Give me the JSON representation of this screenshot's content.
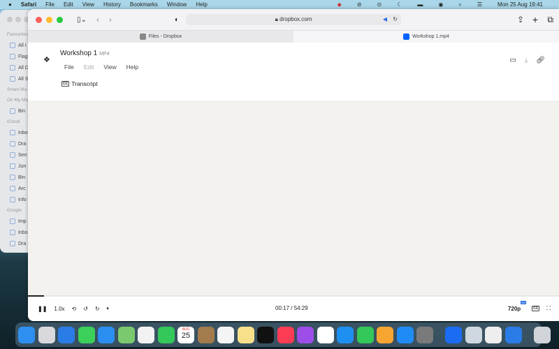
{
  "menubar": {
    "app": "Safari",
    "items": [
      "File",
      "Edit",
      "View",
      "History",
      "Bookmarks",
      "Window",
      "Help"
    ],
    "clock": "Mon 25 Aug  19:41"
  },
  "mail": {
    "sections": [
      {
        "label": "Favourites",
        "items": [
          "All I",
          "Flag",
          "All D",
          "All S"
        ]
      },
      {
        "label": "Smart Ma",
        "items": []
      },
      {
        "label": "On My Ma",
        "items": [
          "Bin"
        ]
      },
      {
        "label": "iCloud",
        "items": [
          "Inbo",
          "Dra",
          "Sen",
          "Jun",
          "Bin",
          "Arc",
          "Info"
        ]
      },
      {
        "label": "Google",
        "items": [
          "Imp",
          "Inbo",
          "Dra"
        ]
      }
    ]
  },
  "safari": {
    "url": "dropbox.com",
    "tabs": [
      {
        "label": "Files - Dropbox",
        "active": false
      },
      {
        "label": "Workshop 1.mp4",
        "active": true
      }
    ]
  },
  "file": {
    "name": "Workshop 1",
    "type": "MP4",
    "menus": [
      "File",
      "Edit",
      "View",
      "Help"
    ],
    "transcript": "Transcript",
    "cc": "CC"
  },
  "player": {
    "speed": "1.0x",
    "time": "00:17 / 54:29",
    "quality": "720p",
    "hd": "HD",
    "progress_fraction": 0.005
  },
  "dock": {
    "calendar_day": "25",
    "calendar_month": "AUG",
    "apps": [
      "Finder",
      "Launchpad",
      "Safari",
      "Messages",
      "Mail",
      "Maps",
      "Photos",
      "FaceTime",
      "Calendar",
      "Contacts",
      "Reminders",
      "Notes",
      "TV",
      "Music",
      "Podcasts",
      "News",
      "Keynote",
      "Numbers",
      "Pages",
      "App Store",
      "System Settings",
      "Zoom",
      "Preview",
      "Preview2",
      "Safari",
      "Bin"
    ]
  }
}
